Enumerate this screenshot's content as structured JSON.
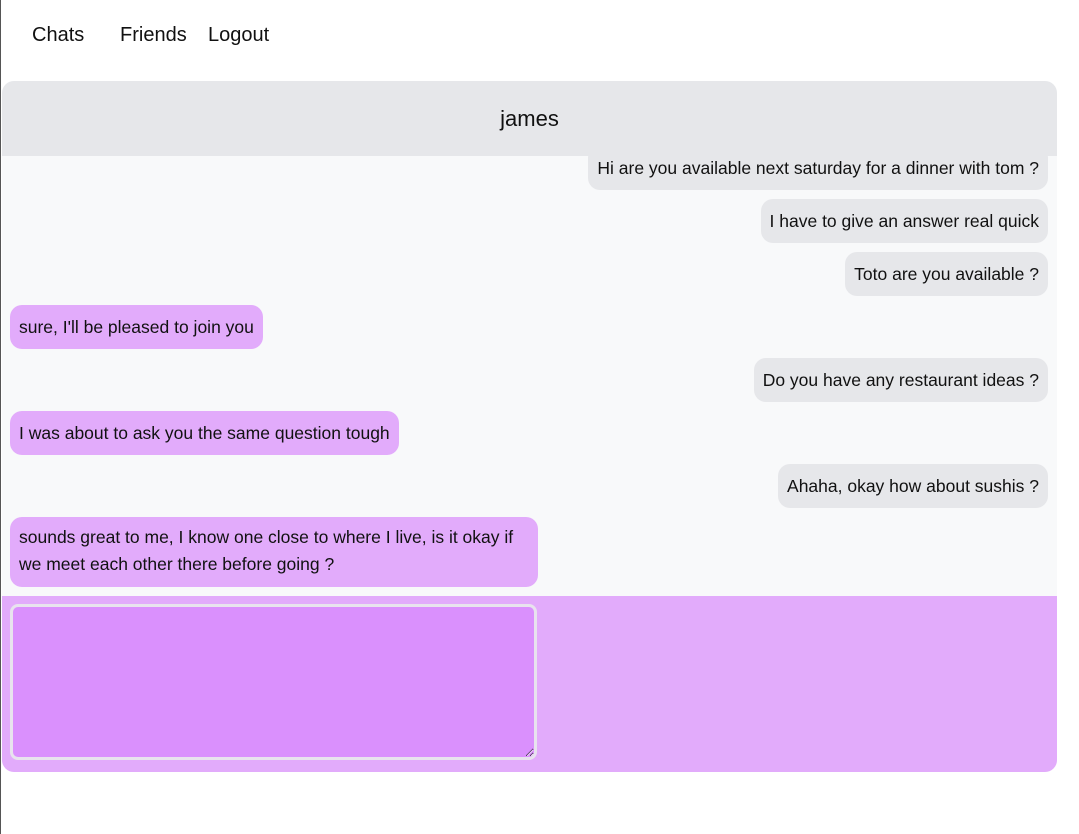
{
  "nav": {
    "chats_label": "Chats",
    "friends_label": "Friends",
    "logout_label": "Logout"
  },
  "chat": {
    "contact_name": "james",
    "messages": [
      {
        "text": "Hi are you available next saturday for a dinner with tom ?",
        "direction": "sent"
      },
      {
        "text": "I have to give an answer real quick",
        "direction": "sent"
      },
      {
        "text": "Toto are you available ?",
        "direction": "sent"
      },
      {
        "text": "sure, I'll be pleased to join you",
        "direction": "received"
      },
      {
        "text": "Do you have any restaurant ideas ?",
        "direction": "sent"
      },
      {
        "text": "I was about to ask you the same question tough",
        "direction": "received"
      },
      {
        "text": "Ahaha, okay how about sushis ?",
        "direction": "sent"
      },
      {
        "text": "sounds great to me, I know one close to where I live, is it okay if we meet each other there before going ?",
        "direction": "received"
      }
    ],
    "composer": {
      "value": "",
      "placeholder": ""
    }
  },
  "colors": {
    "sent_bubble": "#e6e7ea",
    "received_bubble": "#e2abfb",
    "composer_background": "#e2abfb",
    "textarea_background": "#da90fd",
    "header_background": "#e6e7ea"
  }
}
